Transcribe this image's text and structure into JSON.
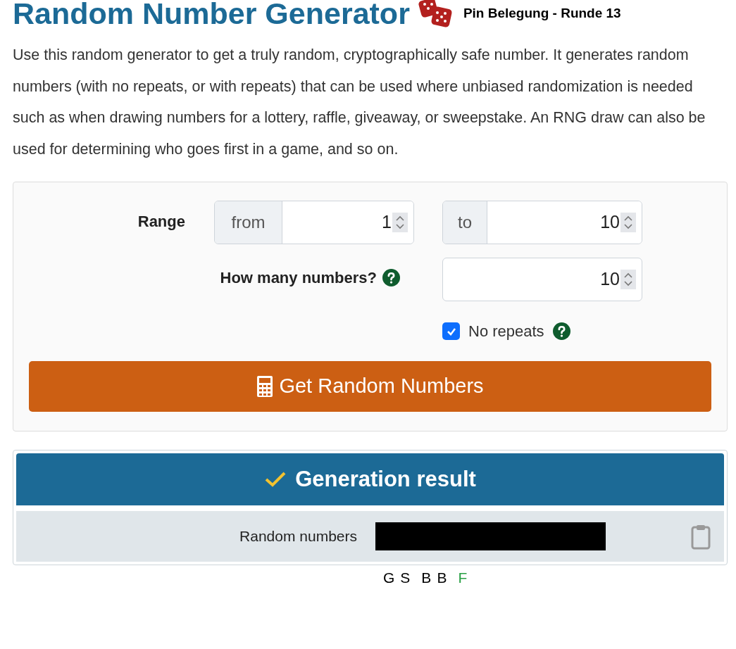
{
  "title": "Random Number Generator",
  "subtitle": "Pin Belegung - Runde 13",
  "intro": "Use this random generator to get a truly random, cryptographically safe number. It generates random numbers (with no repeats, or with repeats) that can be used where unbiased randomization is needed such as when drawing numbers for a lottery, raffle, giveaway, or sweepstake. An RNG draw can also be used for determining who goes first in a game, and so on.",
  "form": {
    "range_label": "Range",
    "from_addon": "from",
    "from_value": "1",
    "to_addon": "to",
    "to_value": "10",
    "count_label": "How many numbers?",
    "count_value": "10",
    "no_repeats": {
      "label": "No repeats",
      "checked": true
    },
    "button": "Get Random Numbers"
  },
  "result": {
    "header": "Generation result",
    "row_label": "Random numbers",
    "redacted": true
  },
  "legend": [
    {
      "letter": "G",
      "color": "#000000"
    },
    {
      "letter": "S",
      "color": "#000000"
    },
    {
      "letter": "B",
      "color": "#000000"
    },
    {
      "letter": "B",
      "color": "#000000"
    },
    {
      "letter": "F",
      "color": "#2aa045"
    }
  ]
}
